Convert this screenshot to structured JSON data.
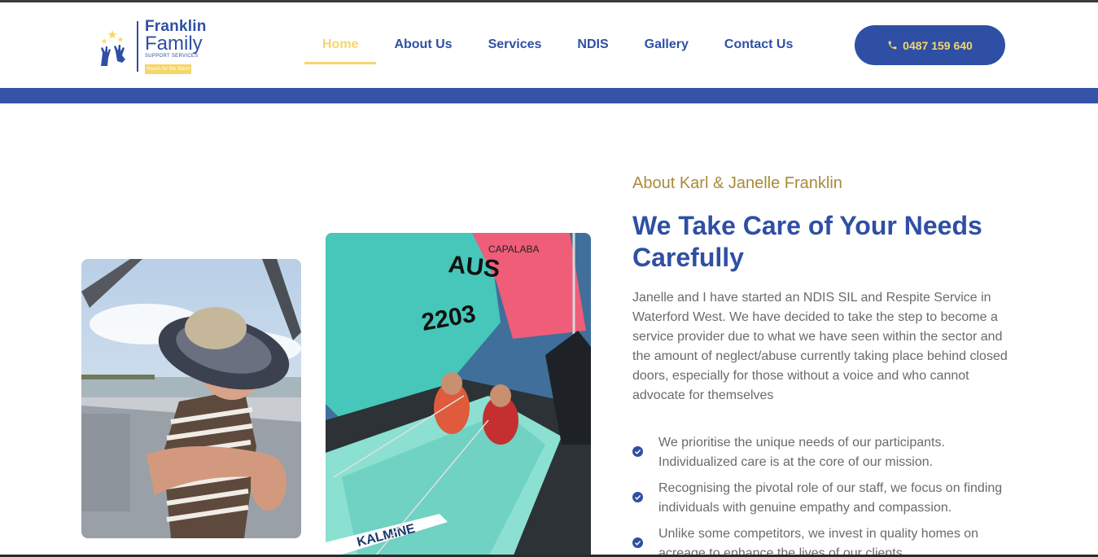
{
  "brand": {
    "line1": "Franklin",
    "line2": "Family",
    "line3": "SUPPORT SERVICES",
    "tagline": "Reach for the Stars!",
    "logo_icon": "hands-stars-icon"
  },
  "nav": {
    "items": [
      {
        "label": "Home",
        "active": true
      },
      {
        "label": "About Us"
      },
      {
        "label": "Services"
      },
      {
        "label": "NDIS"
      },
      {
        "label": "Gallery"
      },
      {
        "label": "Contact Us"
      }
    ]
  },
  "phone": {
    "label": "0487 159 640",
    "icon": "phone-icon"
  },
  "about": {
    "eyebrow": "About Karl & Janelle Franklin",
    "heading": "We Take Care of Your Needs Carefully",
    "intro": "Janelle and I have started an NDIS SIL and Respite Service in Waterford West. We have decided to take the step to become a service provider due to what we have seen within the sector and the amount of neglect/abuse currently taking place behind closed doors, especially for those without a voice and who cannot advocate for themselves",
    "features": [
      "We prioritise the unique needs of our participants. Individualized care is at the core of our mission.",
      "Recognising the pivotal role of our staff, we focus on finding individuals with genuine empathy and compassion.",
      "Unlike some competitors, we invest in quality homes on acreage to enhance the lives of our clients."
    ]
  },
  "photo2_sail": {
    "line1": "AUS",
    "line2": "2203",
    "banner": "CAPALABA",
    "hull": "KALMINE"
  },
  "colors": {
    "brand_blue": "#2e4fa3",
    "accent_yellow": "#f5d66b",
    "eyebrow_gold": "#a98b3a",
    "band_blue": "#3553a8"
  }
}
